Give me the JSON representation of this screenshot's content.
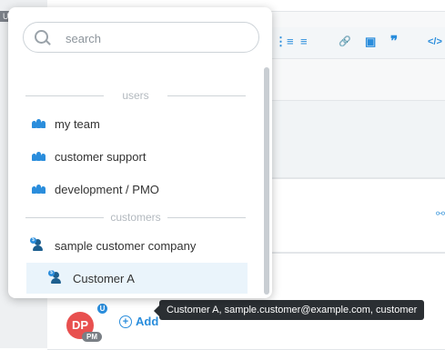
{
  "side_label": "UN",
  "toolbar": {
    "icons": [
      "ordered-list-icon",
      "bullet-list-icon",
      "link-icon",
      "image-icon",
      "quote-icon",
      "code-icon"
    ],
    "glyphs": [
      "⋮≡",
      "≡",
      "🔗",
      "▣",
      "❞",
      "</>"
    ]
  },
  "search": {
    "placeholder": "search"
  },
  "sections": [
    {
      "label": "users"
    },
    {
      "label": "customers"
    }
  ],
  "users": [
    {
      "label": "my team",
      "icon": "team-icon"
    },
    {
      "label": "customer support",
      "icon": "team-icon"
    },
    {
      "label": "development / PMO",
      "icon": "team-icon"
    }
  ],
  "customers": [
    {
      "label": "sample customer company",
      "icon": "customer-company-icon"
    },
    {
      "label": "Customer A",
      "icon": "customer-icon",
      "selected": true
    }
  ],
  "avatar": {
    "initials": "DP",
    "role": "PM",
    "badge": "U",
    "color": "#e8504f"
  },
  "add": {
    "label": "Add"
  },
  "tooltip": {
    "text": "Customer A, sample.customer@example.com, customer"
  },
  "colors": {
    "accent": "#2a8ddc",
    "tooltip_bg": "#2b2f33",
    "selected_bg": "#eaf4fb"
  }
}
